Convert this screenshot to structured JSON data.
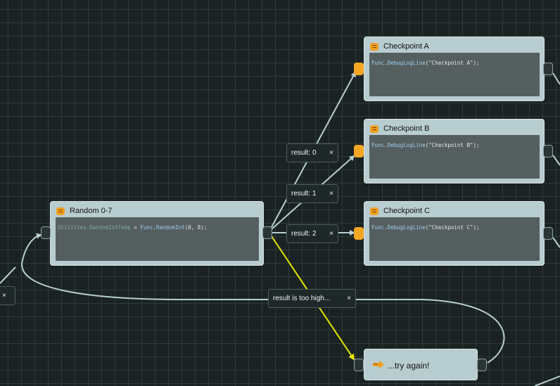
{
  "nodes": {
    "checkpoint_a": {
      "title": "Checkpoint A",
      "code_obj": "Func",
      "code_fn": "DebugLogLine",
      "code_args": "(\"Checkpoint A\");"
    },
    "checkpoint_b": {
      "title": "Checkpoint B",
      "code_obj": "Func",
      "code_fn": "DebugLogLine",
      "code_args": "(\"Checkpoint B\");"
    },
    "checkpoint_c": {
      "title": "Checkpoint C",
      "code_obj": "Func",
      "code_fn": "DebugLogLine",
      "code_args": "(\"Checkpoint C\");"
    },
    "random": {
      "title": "Random 0-7",
      "code_obj": "Utilities",
      "code_var": "RandomIntTemp",
      "code_eq": " = ",
      "code_fn_obj": "Func",
      "code_fn": "RandomInt",
      "code_args": "(0, 8);"
    },
    "try_again": {
      "title": "...try again!"
    }
  },
  "edge_labels": {
    "result0": "result: 0",
    "result1": "result: 1",
    "result2": "result: 2",
    "too_high": "result is too high..."
  },
  "close_glyph": "×",
  "colors": {
    "edge": "#b9cfd2",
    "edge_highlight": "#e6e600",
    "port_active": "#f5a623"
  }
}
